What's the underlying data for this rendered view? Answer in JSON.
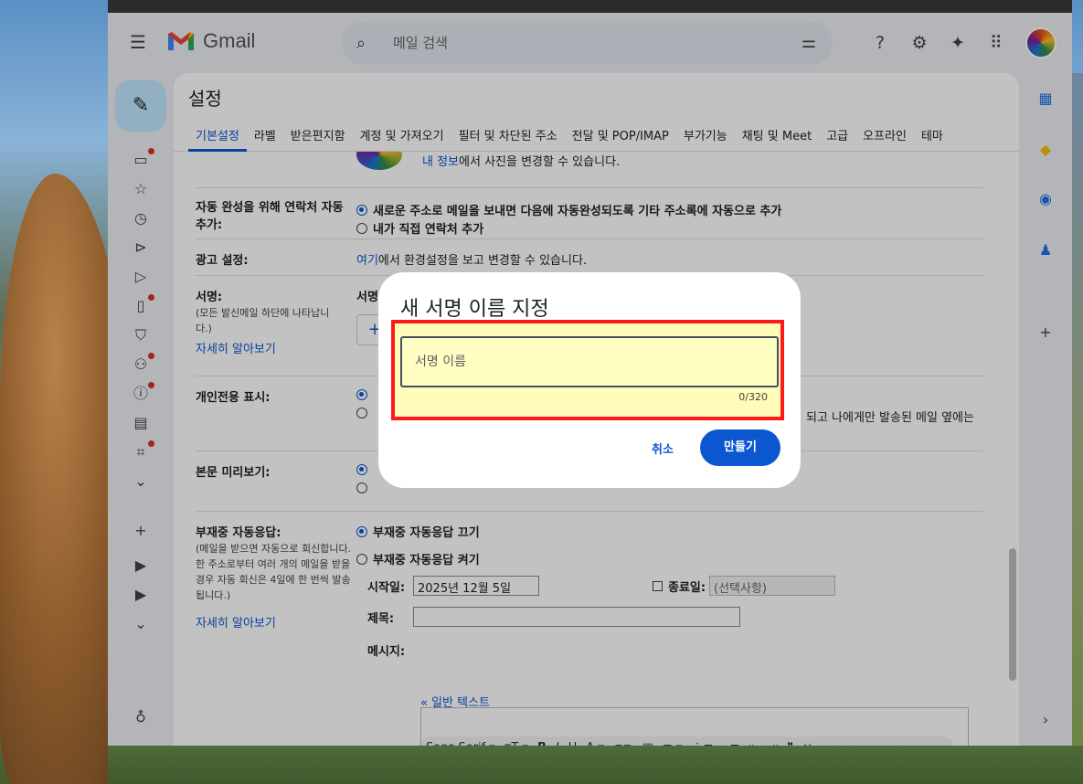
{
  "header": {
    "app_name": "Gmail",
    "search_placeholder": "메일 검색"
  },
  "settings": {
    "title": "설정",
    "tabs": [
      "기본설정",
      "라벨",
      "받은편지함",
      "계정 및 가져오기",
      "필터 및 차단된 주소",
      "전달 및 POP/IMAP",
      "부가기능",
      "채팅 및 Meet",
      "고급",
      "오프라인",
      "테마"
    ],
    "profile_link": "내 정보",
    "profile_text": "에서 사진을 변경할 수 있습니다.",
    "autocomplete": {
      "label": "자동 완성을 위해 연락처 자동 추가:",
      "opt1": "새로운 주소로 메일을 보내면 다음에 자동완성되도록 기타 주소록에 자동으로 추가",
      "opt2": "내가 직접 연락처 추가"
    },
    "ads": {
      "label": "광고 설정:",
      "link": "여기",
      "text": "에서 환경설정을 보고 변경할 수 있습니다."
    },
    "signature": {
      "label": "서명:",
      "sub": "(모든 발신메일 하단에 나타납니다.)",
      "learn_more": "자세히 알아보기",
      "right_label": "서명"
    },
    "personal": {
      "label": "개인전용 표시:",
      "fragment": "되고 나에게만 발송된 메일 옆에는"
    },
    "preview": {
      "label": "본문 미리보기:"
    },
    "vacation": {
      "label": "부재중 자동응답:",
      "sub": "(메일을 받으면 자동으로 회신합니다. 한 주소로부터 여러 개의 메일을 받을 경우 자동 회신은 4일에 한 번씩 발송됩니다.)",
      "learn_more": "자세히 알아보기",
      "off": "부재중 자동응답 끄기",
      "on": "부재중 자동응답 켜기",
      "start_label": "시작일:",
      "start_value": "2025년 12월 5일",
      "end_label": "종료일:",
      "end_placeholder": "(선택사항)",
      "subject_label": "제목:",
      "message_label": "메시지:",
      "font": "Sans Serif",
      "plain_text": "« 일반 텍스트"
    }
  },
  "dialog": {
    "title": "새 서명 이름 지정",
    "placeholder": "서명 이름",
    "counter": "0/320",
    "cancel": "취소",
    "create": "만들기"
  }
}
